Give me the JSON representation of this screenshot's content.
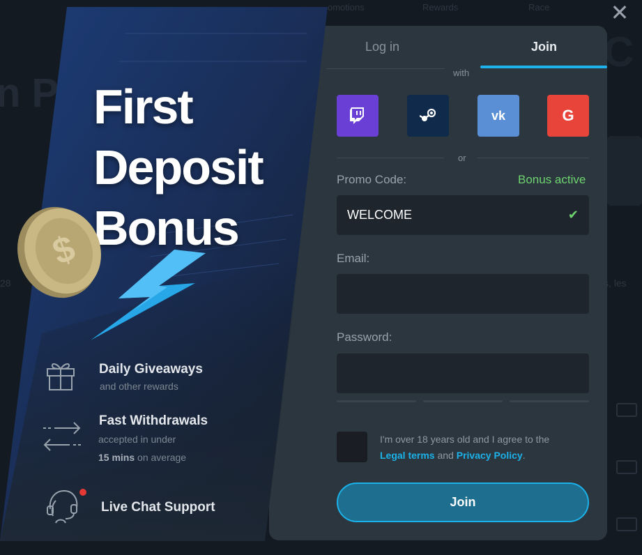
{
  "background": {
    "nav_items": [
      "omotions",
      "Rewards",
      "Race"
    ],
    "headline": "n Pr",
    "number": "28",
    "right_text": "s, les"
  },
  "promo": {
    "title_lines": [
      "First",
      "Deposit",
      "Bonus"
    ],
    "features": [
      {
        "icon": "gift-icon",
        "title": "Daily Giveaways",
        "subtitle": "and other rewards"
      },
      {
        "icon": "transfer-arrows-icon",
        "title": "Fast Withdrawals",
        "subtitle_line1": "accepted in under",
        "subtitle_bold": "15 mins",
        "subtitle_rest": " on average"
      },
      {
        "icon": "headset-icon",
        "title": "Live Chat Support"
      }
    ]
  },
  "modal": {
    "tabs": {
      "login": "Log in",
      "join": "Join"
    },
    "with_label": "with",
    "social": [
      {
        "name": "twitch",
        "icon": "twitch-icon",
        "color": "#6a3fd6"
      },
      {
        "name": "steam",
        "icon": "steam-icon",
        "color": "#0f2a4a"
      },
      {
        "name": "vk",
        "icon": "vk-icon",
        "color": "#5a8fd5"
      },
      {
        "name": "google",
        "icon": "google-icon",
        "color": "#e8443a"
      }
    ],
    "or_label": "or",
    "promo_label": "Promo Code:",
    "bonus_status": "Bonus active",
    "promo_value": "WELCOME",
    "email_label": "Email:",
    "email_value": "",
    "password_label": "Password:",
    "password_value": "",
    "terms": {
      "prefix": "I'm over 18 years old and I agree to the",
      "legal": "Legal terms",
      "and": " and ",
      "privacy": "Privacy Policy",
      "suffix": "."
    },
    "join_button": "Join"
  },
  "colors": {
    "accent": "#1cb1e8",
    "success": "#6fd46f",
    "modal_bg": "#2b363f",
    "input_bg": "#1f252d"
  }
}
